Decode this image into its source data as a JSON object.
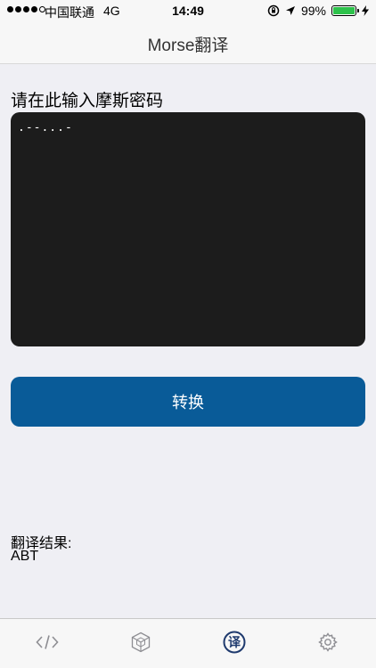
{
  "status_bar": {
    "carrier": "中国联通",
    "network": "4G",
    "time": "14:49",
    "battery_percent": "99%"
  },
  "nav": {
    "title": "Morse翻译"
  },
  "input": {
    "label": "请在此输入摩斯密码",
    "value": ".--...-"
  },
  "convert_button": {
    "label": "转换"
  },
  "result": {
    "label": "翻译结果:",
    "value": "ABT"
  },
  "tab_bar": {
    "tabs": [
      {
        "icon": "code-icon",
        "selected": false
      },
      {
        "icon": "cube-icon",
        "selected": false
      },
      {
        "icon": "translate-icon",
        "glyph": "译",
        "selected": true
      },
      {
        "icon": "gear-icon",
        "selected": false
      }
    ]
  },
  "colors": {
    "accent": "#095b98",
    "input_background": "#1c1c1c",
    "selected_tab": "#1f3a6e",
    "battery": "#2dc24b"
  }
}
